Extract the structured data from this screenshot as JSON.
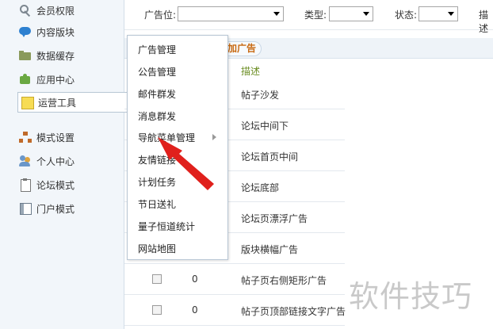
{
  "sidebar": {
    "items": [
      {
        "label": "会员权限",
        "icon": "key-icon"
      },
      {
        "label": "内容版块",
        "icon": "chat-bubble-icon"
      },
      {
        "label": "数据缓存",
        "icon": "folder-icon"
      },
      {
        "label": "应用中心",
        "icon": "puzzle-icon"
      },
      {
        "label": "运营工具",
        "icon": "note-icon",
        "active": true
      },
      {
        "label": "模式设置",
        "icon": "sitemap-icon"
      },
      {
        "label": "个人中心",
        "icon": "users-icon"
      },
      {
        "label": "论坛模式",
        "icon": "clipboard-icon"
      },
      {
        "label": "门户模式",
        "icon": "layout-icon"
      }
    ]
  },
  "filter": {
    "position_label": "广告位:",
    "type_label": "类型:",
    "status_label": "状态:",
    "desc_label": "描述"
  },
  "table": {
    "add_label": "加广告",
    "desc_header": "描述",
    "rows": [
      {
        "num": "",
        "desc": "帖子沙发"
      },
      {
        "num": "",
        "desc": "论坛中间下"
      },
      {
        "num": "",
        "desc": "论坛首页中间"
      },
      {
        "num": "",
        "desc": "论坛底部"
      },
      {
        "num": "",
        "desc": "论坛页漂浮广告"
      },
      {
        "num": "",
        "desc": "版块横幅广告"
      },
      {
        "num": "0",
        "desc": "帖子页右侧矩形广告"
      },
      {
        "num": "0",
        "desc": "帖子页顶部链接文字广告"
      }
    ]
  },
  "menu": {
    "items": [
      {
        "label": "广告管理"
      },
      {
        "label": "公告管理"
      },
      {
        "label": "邮件群发"
      },
      {
        "label": "消息群发"
      },
      {
        "label": "导航菜单管理",
        "has_submenu": true
      },
      {
        "label": "友情链接"
      },
      {
        "label": "计划任务"
      },
      {
        "label": "节日送礼"
      },
      {
        "label": "量子恒道统计"
      },
      {
        "label": "网站地图"
      }
    ]
  },
  "watermark": "软件技巧",
  "colors": {
    "sidebar_bg": "#f2f6fa",
    "accent_orange": "#c86a12",
    "header_green": "#6b8e23",
    "arrow_red": "#e0201c"
  }
}
